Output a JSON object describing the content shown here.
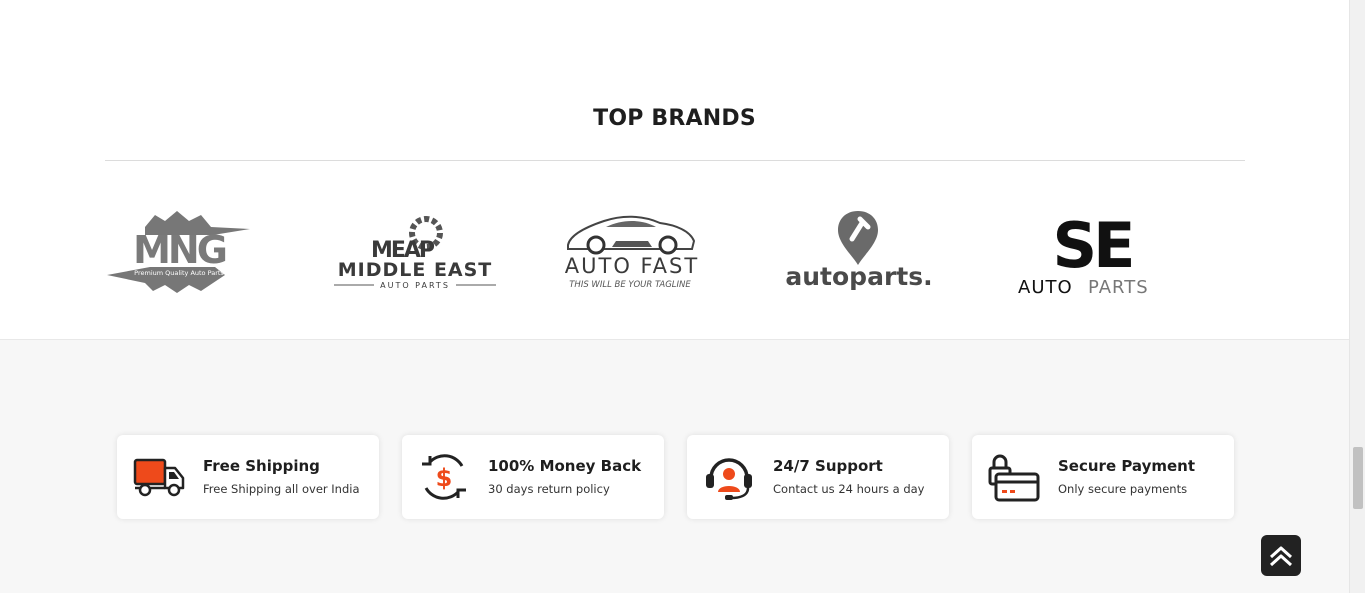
{
  "brands": {
    "title": "TOP BRANDS",
    "logos": [
      {
        "name": "MNG",
        "tagline": "Premium Quality Auto Parts"
      },
      {
        "name_top": "MEAP",
        "name": "MIDDLE EAST",
        "tagline": "AUTO PARTS"
      },
      {
        "name": "AUTO FAST",
        "tagline": "THIS WILL BE YOUR TAGLINE"
      },
      {
        "name": "autoparts."
      },
      {
        "name_top": "SE",
        "name_left": "AUTO",
        "name_right": "PARTS"
      }
    ]
  },
  "features": [
    {
      "icon": "truck-icon",
      "title": "Free Shipping",
      "subtitle": "Free Shipping all over India"
    },
    {
      "icon": "money-back-icon",
      "title": "100% Money Back",
      "subtitle": "30 days return policy"
    },
    {
      "icon": "support-headset-icon",
      "title": "24/7 Support",
      "subtitle": "Contact us 24 hours a day"
    },
    {
      "icon": "secure-payment-icon",
      "title": "Secure Payment",
      "subtitle": "Only secure payments"
    }
  ],
  "colors": {
    "accent": "#ee4a1b",
    "dark": "#222222",
    "logo_gray": "#777777"
  }
}
